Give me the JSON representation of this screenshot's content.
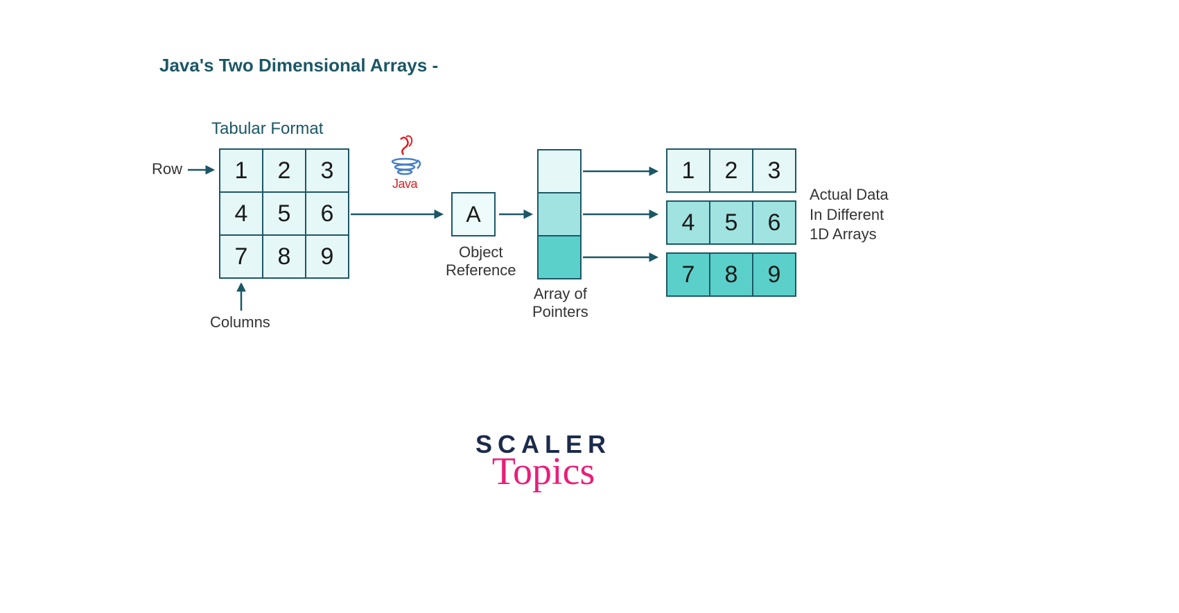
{
  "title": "Java's Two Dimensional Arrays -",
  "labels": {
    "tabular": "Tabular Format",
    "row": "Row",
    "columns": "Columns",
    "objectRef": "Object\nReference",
    "arrayPointers": "Array of\nPointers",
    "actualData": "Actual Data\nIn Different\n1D Arrays"
  },
  "grid": {
    "r0c0": "1",
    "r0c1": "2",
    "r0c2": "3",
    "r1c0": "4",
    "r1c1": "5",
    "r1c2": "6",
    "r2c0": "7",
    "r2c1": "8",
    "r2c2": "9"
  },
  "objectRefValue": "A",
  "dataRows": {
    "row0": {
      "c0": "1",
      "c1": "2",
      "c2": "3"
    },
    "row1": {
      "c0": "4",
      "c1": "5",
      "c2": "6"
    },
    "row2": {
      "c0": "7",
      "c1": "8",
      "c2": "9"
    }
  },
  "javaLabel": "Java",
  "brand": {
    "scaler": "SCALER",
    "topics": "Topics"
  },
  "colors": {
    "teal": "#1b5766",
    "lightCell": "#e6f7f7",
    "medCell": "#a0e3e0",
    "darkCell": "#5bd0ca",
    "javaRed": "#e01e23",
    "brandBlue": "#1c2b4b",
    "brandPink": "#e91e7a"
  }
}
